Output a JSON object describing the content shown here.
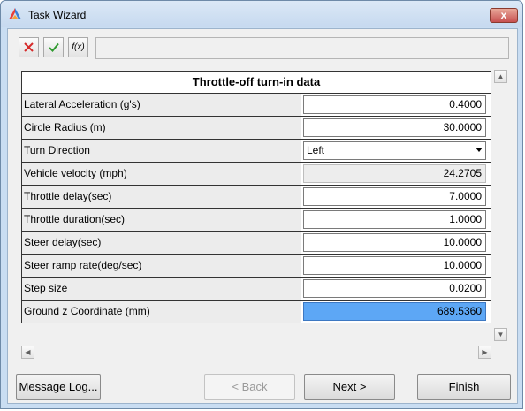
{
  "window": {
    "title": "Task Wizard",
    "close_label": "x",
    "app_icon": "hyperworks-logo-icon"
  },
  "toolbar": {
    "cancel_icon": "red-x-icon",
    "apply_icon": "green-checkmark-icon",
    "fx_label": "f(x)",
    "expression_value": ""
  },
  "table": {
    "title": "Throttle-off turn-in data",
    "rows": [
      {
        "label": "Lateral Acceleration (g's)",
        "value": "0.4000"
      },
      {
        "label": "Circle Radius (m)",
        "value": "30.0000"
      },
      {
        "label": "Turn Direction",
        "value": "Left"
      },
      {
        "label": "Vehicle velocity (mph)",
        "value": "24.2705"
      },
      {
        "label": "Throttle delay(sec)",
        "value": "7.0000"
      },
      {
        "label": "Throttle duration(sec)",
        "value": "1.0000"
      },
      {
        "label": "Steer delay(sec)",
        "value": "10.0000"
      },
      {
        "label": "Steer ramp rate(deg/sec)",
        "value": "10.0000"
      },
      {
        "label": "Step size",
        "value": "0.0200"
      },
      {
        "label": "Ground z Coordinate (mm)",
        "value": "689.5360"
      }
    ]
  },
  "buttons": {
    "message_log": "Message Log...",
    "back": "< Back",
    "next": "Next >",
    "finish": "Finish"
  },
  "colors": {
    "selection": "#5da7f5",
    "title_bar": "#c9ddf2"
  }
}
